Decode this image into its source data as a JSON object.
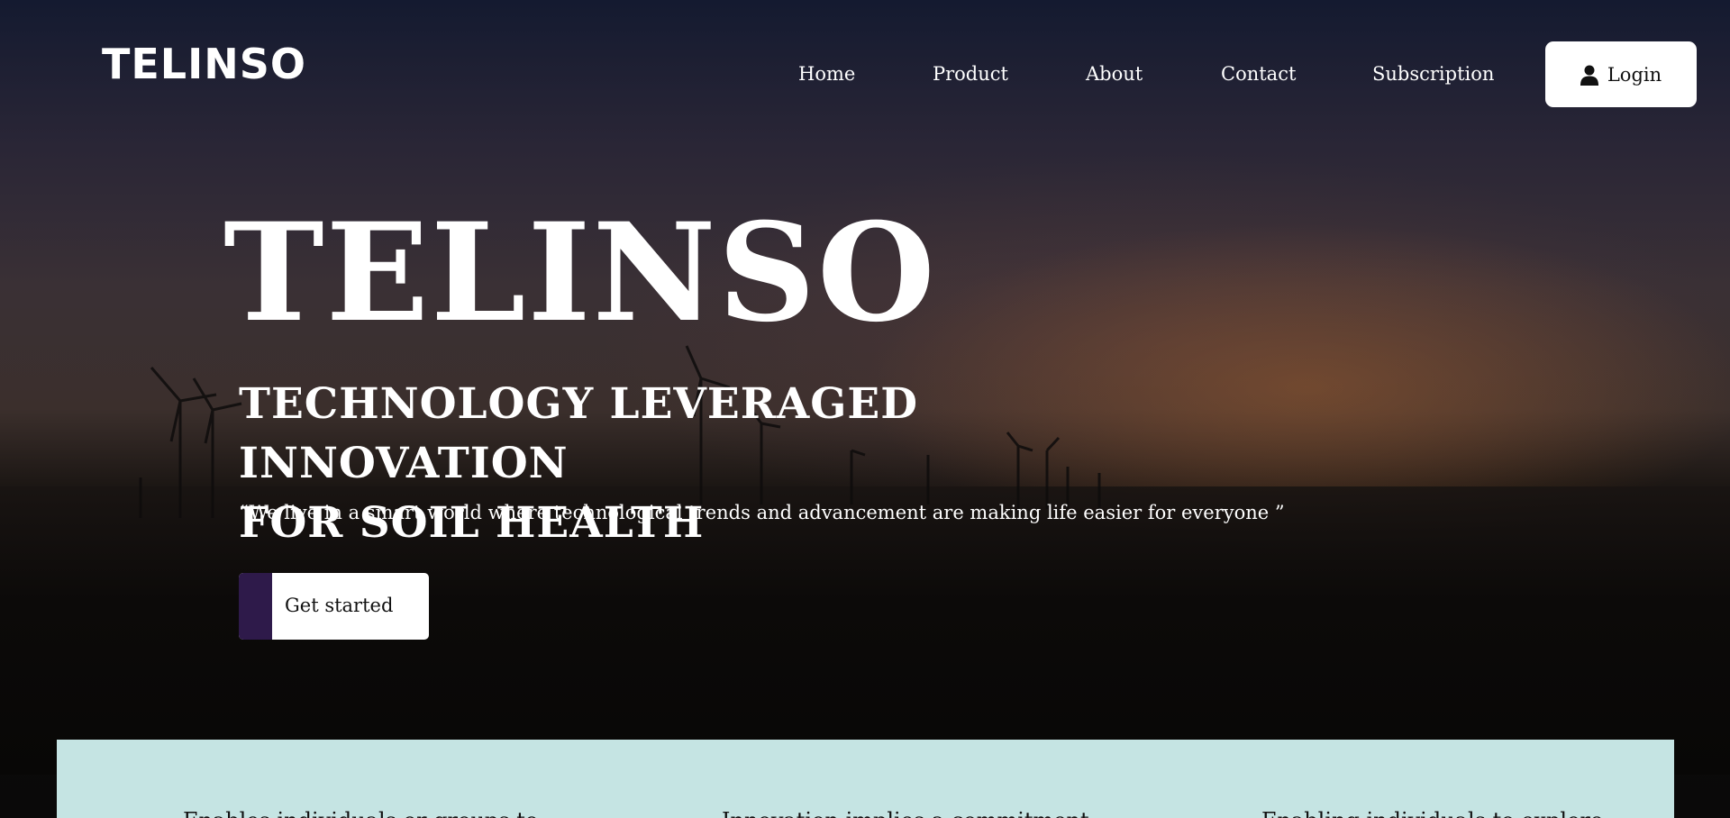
{
  "nav": {
    "logo": "TELINSO",
    "links": [
      "Home",
      "Product",
      "About",
      "Contact",
      "Subscription"
    ],
    "login_label": "Login",
    "login_icon": "user-icon"
  },
  "hero": {
    "title": "TELINSO",
    "subtitle_line1": "TECHNOLOGY LEVERAGED INNOVATION",
    "subtitle_line2": "FOR SOIL HEALTH",
    "quote": "“We live in a smart world where technological trends and advancement are making life easier for everyone ”",
    "cta_label": "Get started",
    "cta_accent_color": "#2e1a4a"
  },
  "features": {
    "background_color": "#c5e4e3",
    "items": [
      "Enables individuals or groups to",
      "Innovation implies a commitment",
      "Enabling individuals to explore"
    ]
  }
}
